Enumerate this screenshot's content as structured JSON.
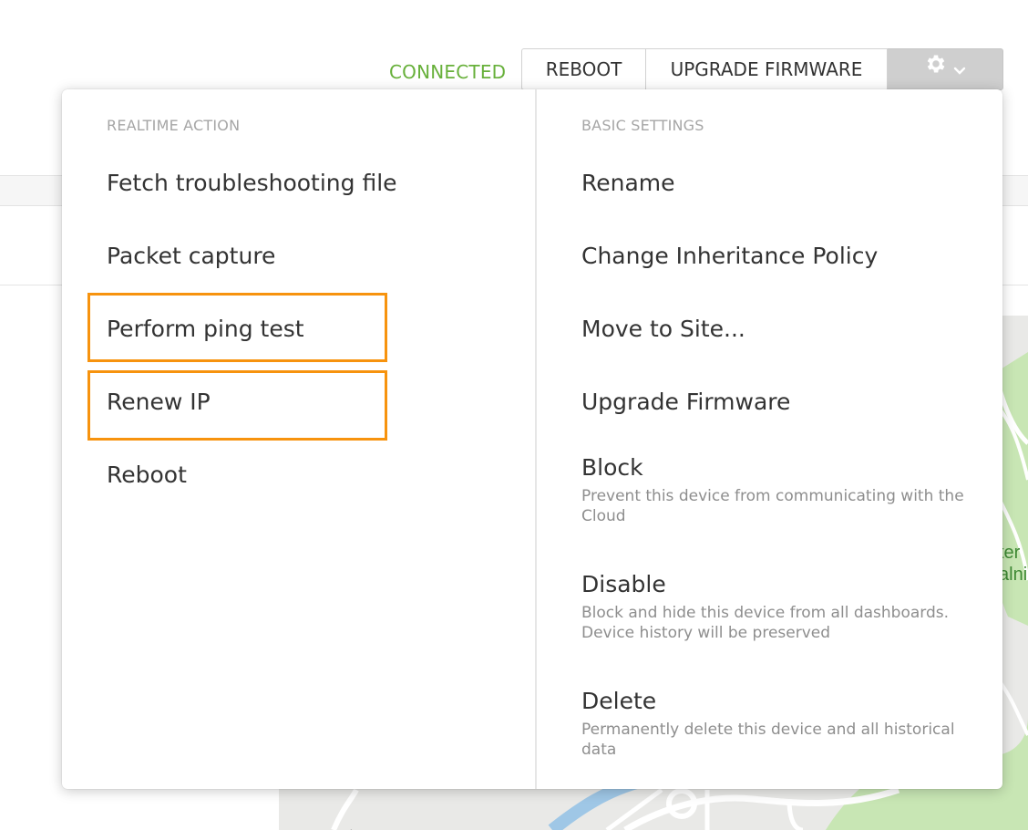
{
  "toolbar": {
    "status": "CONNECTED",
    "reboot_label": "REBOOT",
    "upgrade_label": "UPGRADE FIRMWARE",
    "gear_icon": "gear-icon",
    "chevron_icon": "chevron-down-icon"
  },
  "colors": {
    "status": "#67b03a",
    "highlight": "#f7930e"
  },
  "menu": {
    "left": {
      "title": "REALTIME ACTION",
      "items": [
        {
          "label": "Fetch troubleshooting file"
        },
        {
          "label": "Packet capture"
        },
        {
          "label": "Perform ping test"
        },
        {
          "label": "Renew IP"
        },
        {
          "label": "Reboot"
        }
      ]
    },
    "right": {
      "title": "BASIC SETTINGS",
      "items": [
        {
          "label": "Rename"
        },
        {
          "label": "Change Inheritance Policy"
        },
        {
          "label": "Move to Site..."
        },
        {
          "label": "Upgrade Firmware"
        },
        {
          "label": "Block",
          "desc": "Prevent this device from communicating with the Cloud"
        },
        {
          "label": "Disable",
          "desc": "Block and hide this device from all dashboards. Device history will be preserved"
        },
        {
          "label": "Delete",
          "desc": "Permanently delete this device and all historical data"
        }
      ]
    }
  },
  "map": {
    "labels": [
      "ter",
      "alni",
      "nktin"
    ]
  }
}
